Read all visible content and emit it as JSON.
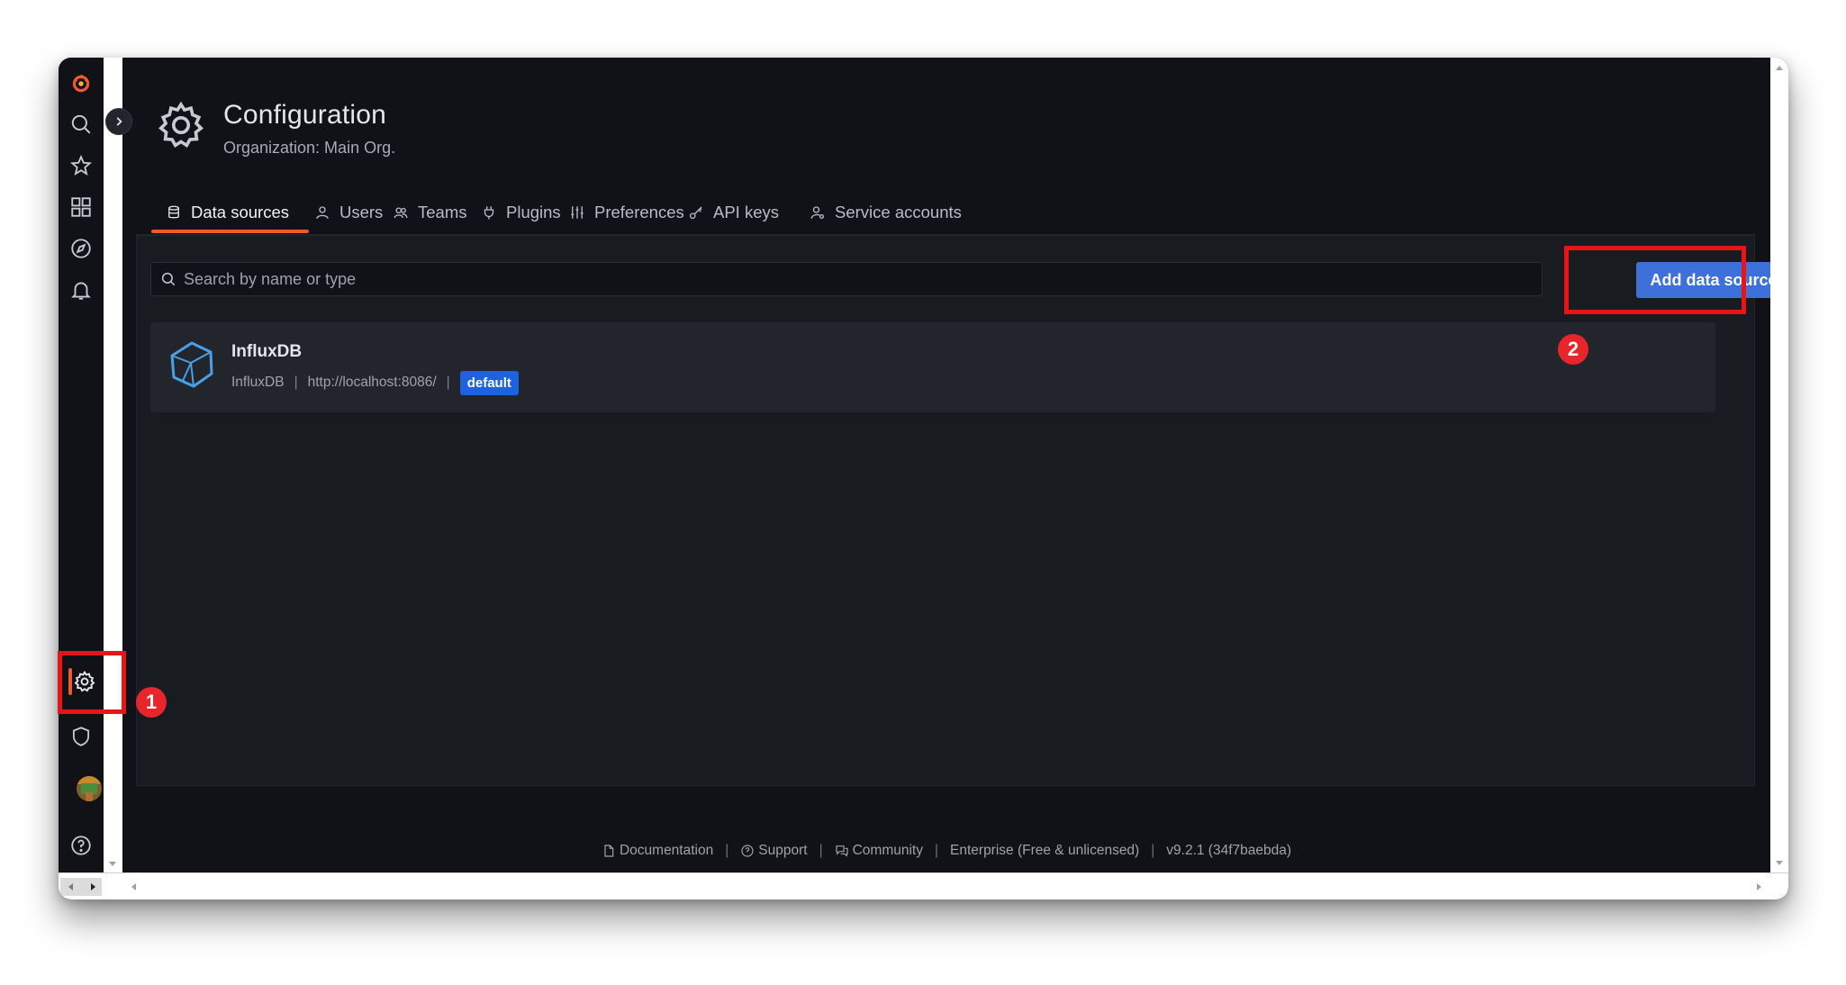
{
  "header": {
    "title": "Configuration",
    "subtitle": "Organization: Main Org."
  },
  "tabs": [
    {
      "label": "Data sources",
      "icon": "database-icon",
      "active": true
    },
    {
      "label": "Users",
      "icon": "user-icon"
    },
    {
      "label": "Teams",
      "icon": "users-icon"
    },
    {
      "label": "Plugins",
      "icon": "plug-icon"
    },
    {
      "label": "Preferences",
      "icon": "sliders-icon"
    },
    {
      "label": "API keys",
      "icon": "key-icon"
    },
    {
      "label": "Service accounts",
      "icon": "service-account-icon"
    }
  ],
  "search": {
    "placeholder": "Search by name or type"
  },
  "actions": {
    "add_label": "Add data source"
  },
  "datasources": [
    {
      "name": "InfluxDB",
      "type": "InfluxDB",
      "url": "http://localhost:8086/",
      "badge": "default"
    }
  ],
  "footer": {
    "documentation": "Documentation",
    "support": "Support",
    "community": "Community",
    "edition": "Enterprise (Free & unlicensed)",
    "version": "v9.2.1 (34f7baebda)"
  },
  "separator": "|",
  "annotations": {
    "one": "1",
    "two": "2"
  },
  "colors": {
    "accent": "#f05a28",
    "primary_button": "#3d71d9",
    "annotation": "#e81418",
    "background": "#111217"
  }
}
